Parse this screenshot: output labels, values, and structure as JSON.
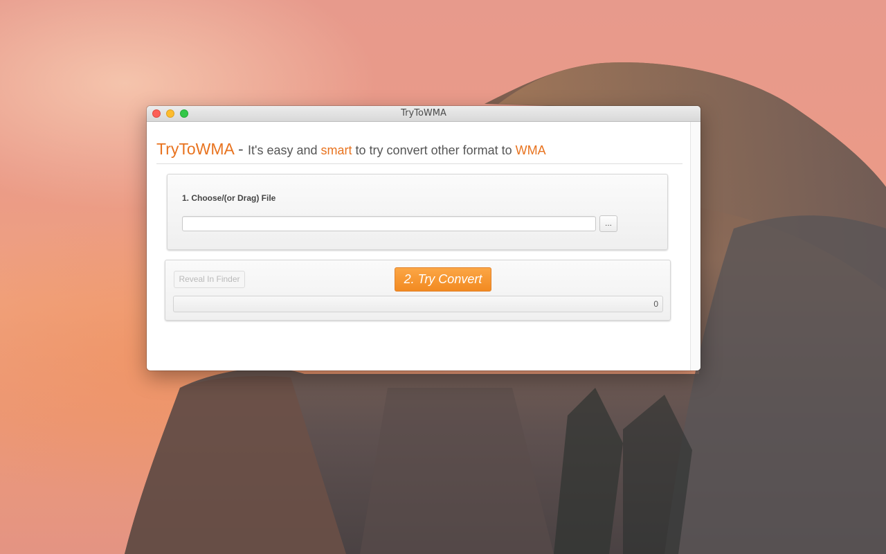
{
  "window": {
    "title": "TryToWMA"
  },
  "header": {
    "brand": "TryToWMA",
    "dash": " - ",
    "text_1": "It's easy and ",
    "accent_1": "smart",
    "text_2": " to try convert other format to ",
    "accent_2": "WMA"
  },
  "choose_panel": {
    "label": "1. Choose/(or Drag) File",
    "file_path_value": "",
    "browse_label": "..."
  },
  "convert_panel": {
    "reveal_label": "Reveal In Finder",
    "reveal_enabled": false,
    "convert_label": "2. Try Convert",
    "progress_value": "0"
  },
  "colors": {
    "accent": "#e8731f",
    "button_orange": "#f28a21",
    "text": "#555555"
  }
}
